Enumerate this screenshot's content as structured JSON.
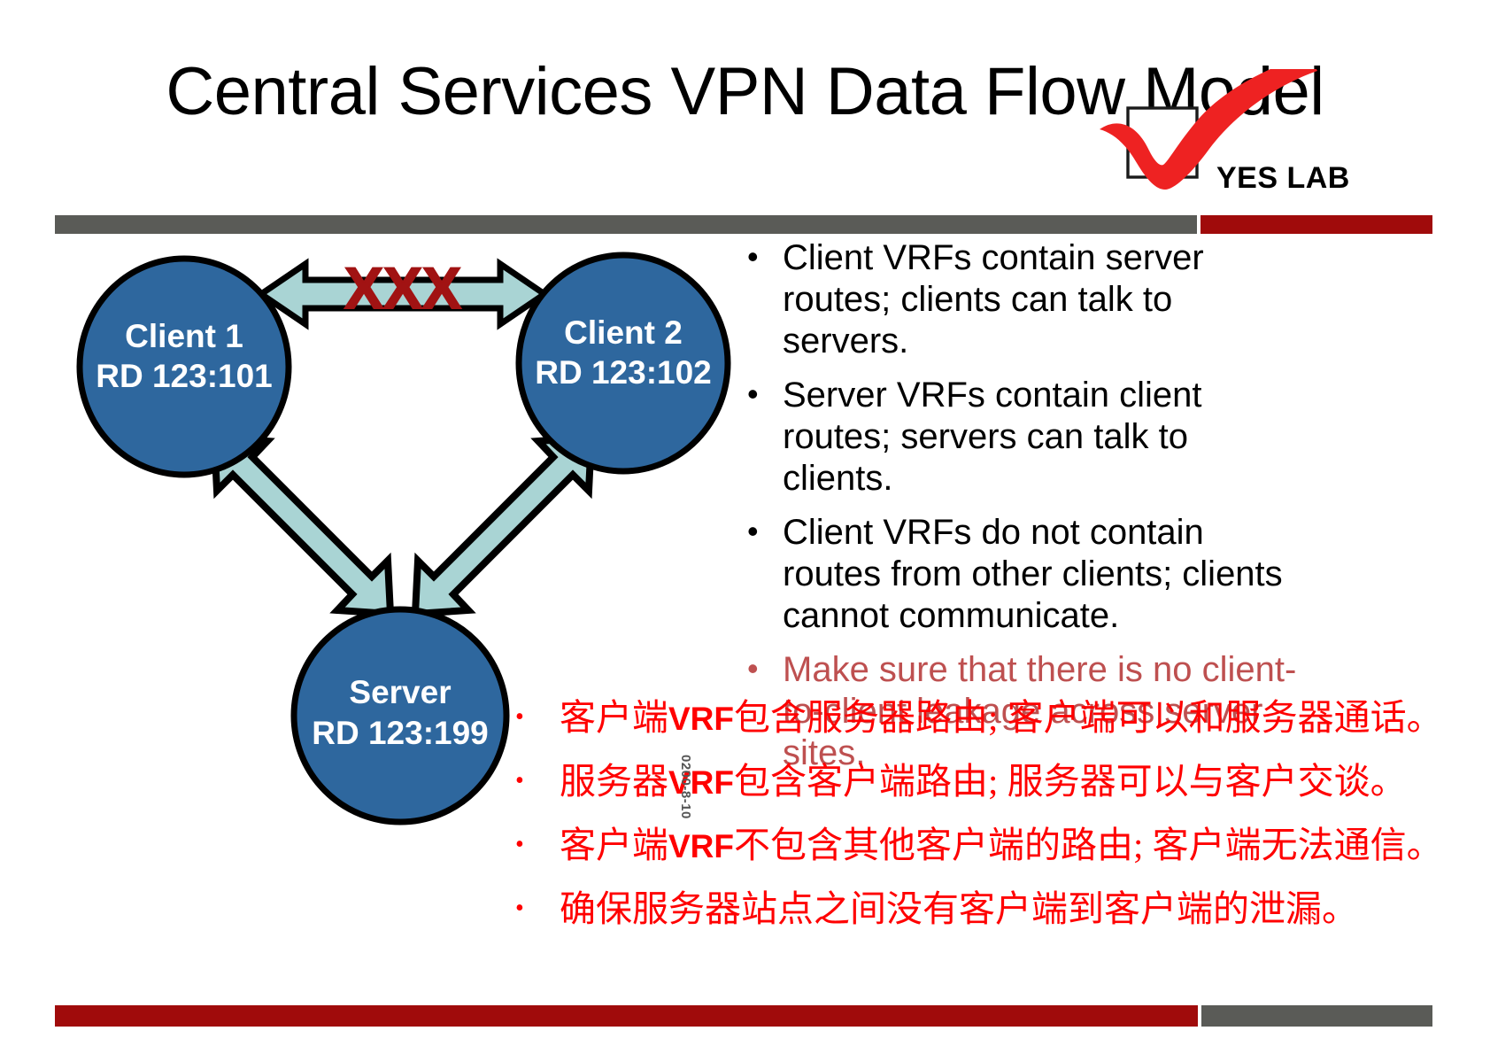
{
  "slide": {
    "title": "Central Services VPN Data Flow Model",
    "watermark": "0200-8-10"
  },
  "logo": {
    "text": "YES LAB",
    "check_color": "#EE2222",
    "box_color": "#000000"
  },
  "bars": {
    "top_gray_color": "#5A5B57",
    "top_red_color": "#A00B0B",
    "bottom_red_color": "#A00B0B",
    "bottom_gray_color": "#5A5B57"
  },
  "diagram": {
    "node_fill": "#2E679E",
    "node_stroke": "#000000",
    "arrow_fill": "#A9D4D4",
    "arrow_stroke": "#000000",
    "blocked_mark": "XXX",
    "blocked_mark_color": "#A11313",
    "nodes": [
      {
        "id": "client1",
        "name": "Client 1",
        "rd": "RD 123:101"
      },
      {
        "id": "client2",
        "name": "Client 2",
        "rd": "RD 123:102"
      },
      {
        "id": "server",
        "name": "Server",
        "rd": "RD 123:199"
      }
    ],
    "links": [
      {
        "from": "client1",
        "to": "client2",
        "state": "blocked",
        "bidirectional": true
      },
      {
        "from": "client1",
        "to": "server",
        "state": "allowed",
        "bidirectional": true
      },
      {
        "from": "client2",
        "to": "server",
        "state": "allowed",
        "bidirectional": true
      }
    ]
  },
  "english_bullets": [
    {
      "text": "Client VRFs contain server routes; clients can talk to servers.",
      "color": "#000000"
    },
    {
      "text": "Server VRFs contain client routes; servers can talk to clients.",
      "color": "#000000"
    },
    {
      "text": "Client VRFs do not contain routes from other clients; clients cannot communicate.",
      "color": "#000000"
    },
    {
      "text": "Make sure that there is no client-to-client leakage across server sites.",
      "color": "#BE5050"
    }
  ],
  "chinese_bullets": [
    {
      "pre": "客户端",
      "latin": "VRF",
      "post": "包含服务器路由; 客户端可以和服务器通话。"
    },
    {
      "pre": "服务器",
      "latin": "VRF",
      "post": "包含客户端路由; 服务器可以与客户交谈。"
    },
    {
      "pre": "客户端",
      "latin": "VRF",
      "post": "不包含其他客户端的路由; 客户端无法通信。"
    },
    {
      "pre": "",
      "latin": "",
      "post": "确保服务器站点之间没有客户端到客户端的泄漏。"
    }
  ]
}
